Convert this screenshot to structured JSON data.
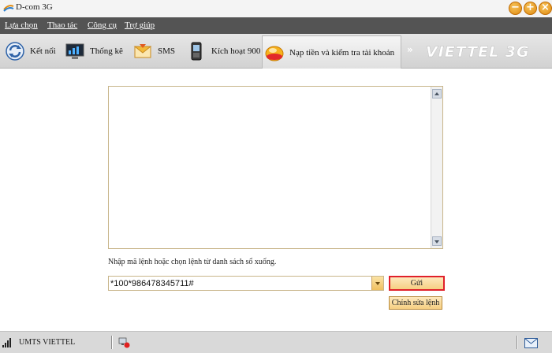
{
  "window": {
    "title": "D-com 3G"
  },
  "menu": {
    "items": [
      {
        "label": "Lựa chọn"
      },
      {
        "label": "Thao tác"
      },
      {
        "label": "Công cụ"
      },
      {
        "label": "Trợ giúp"
      }
    ]
  },
  "toolbar": {
    "items": [
      {
        "label": "Kết nối",
        "icon": "connect-icon"
      },
      {
        "label": "Thống kê",
        "icon": "statistics-icon"
      },
      {
        "label": "SMS",
        "icon": "sms-envelope-icon"
      },
      {
        "label": "Kích hoạt 900",
        "icon": "phone-icon"
      },
      {
        "label": "Nạp tiền và kiểm tra tài khoản",
        "icon": "topup-icon"
      }
    ],
    "more_glyph": "»",
    "brand_text": "VIETTEL 3G"
  },
  "main": {
    "response_text": "",
    "instruction": "Nhập mã lệnh hoặc chọn lệnh từ danh sách sổ xuống.",
    "command_value": "*100*986478345711#",
    "send_label": "Gửi",
    "edit_label": "Chỉnh sửa lệnh"
  },
  "status": {
    "network_text": "UMTS VIETTEL"
  },
  "colors": {
    "menubar": "#545454",
    "brand": "#ffffff",
    "accent_orange": "#f0a020",
    "send_border": "#e0202a"
  }
}
